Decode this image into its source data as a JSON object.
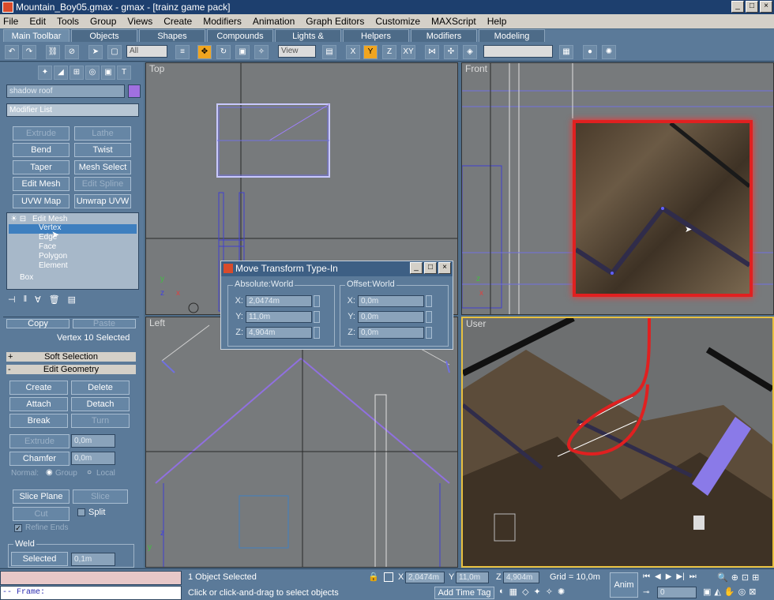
{
  "window": {
    "title": "Mountain_Boy05.gmax - gmax - [trainz game pack]"
  },
  "menu": [
    "File",
    "Edit",
    "Tools",
    "Group",
    "Views",
    "Create",
    "Modifiers",
    "Animation",
    "Graph Editors",
    "Customize",
    "MAXScript",
    "Help"
  ],
  "tabs": [
    "Main Toolbar",
    "Objects",
    "Shapes",
    "Compounds",
    "Lights & Cameras",
    "Helpers",
    "Modifiers",
    "Modeling"
  ],
  "toolbar": {
    "selection_filter": "All",
    "ref_coord": "View"
  },
  "command_panel": {
    "object_name": "shadow roof",
    "modifier_list": "Modifier List",
    "buttons": [
      "Extrude",
      "Lathe",
      "Bend",
      "Twist",
      "Taper",
      "Mesh Select",
      "Edit Mesh",
      "Edit Spline",
      "UVW Map",
      "Unwrap UVW"
    ],
    "stack": [
      "Edit Mesh",
      "Vertex",
      "Edge",
      "Face",
      "Polygon",
      "Element",
      "Box"
    ],
    "copy": "Copy",
    "paste": "Paste",
    "selection_info": "Vertex 10 Selected",
    "soft_selection": "Soft Selection",
    "edit_geometry": "Edit Geometry",
    "geom_buttons": [
      "Create",
      "Delete",
      "Attach",
      "Detach",
      "Break",
      "Turn"
    ],
    "extrude": "Extrude",
    "extrude_val": "0,0m",
    "chamfer": "Chamfer",
    "chamfer_val": "0,0m",
    "normal": "Normal:",
    "group": "Group",
    "local": "Local",
    "slice_plane": "Slice Plane",
    "slice": "Slice",
    "cut": "Cut",
    "split": "Split",
    "refine_ends": "Refine Ends",
    "weld": "Weld",
    "selected": "Selected",
    "weld_val": "0,1m"
  },
  "viewports": {
    "top": "Top",
    "front": "Front",
    "left": "Left",
    "user": "User"
  },
  "dialog": {
    "title": "Move Transform Type-In",
    "absolute": "Absolute:World",
    "offset": "Offset:World",
    "abs": {
      "x": "2,0474m",
      "y": "11,0m",
      "z": "4,904m"
    },
    "off": {
      "x": "0,0m",
      "y": "0,0m",
      "z": "0,0m"
    },
    "axes": [
      "X:",
      "Y:",
      "Z:"
    ]
  },
  "status": {
    "selected": "1 Object Selected",
    "prompt": "Click or click-and-drag to select objects",
    "x": "2,0474m",
    "y": "11,0m",
    "z": "4,904m",
    "grid": "Grid = 10,0m",
    "anim": "Anim",
    "add_time_tag": "Add Time Tag",
    "frame_label": "-- Frame:",
    "frame": "0"
  },
  "colors": {
    "panel": "#5b7a99",
    "viewport": "#777a7c",
    "accent": "#f0a520",
    "highlight": "#e02020"
  }
}
